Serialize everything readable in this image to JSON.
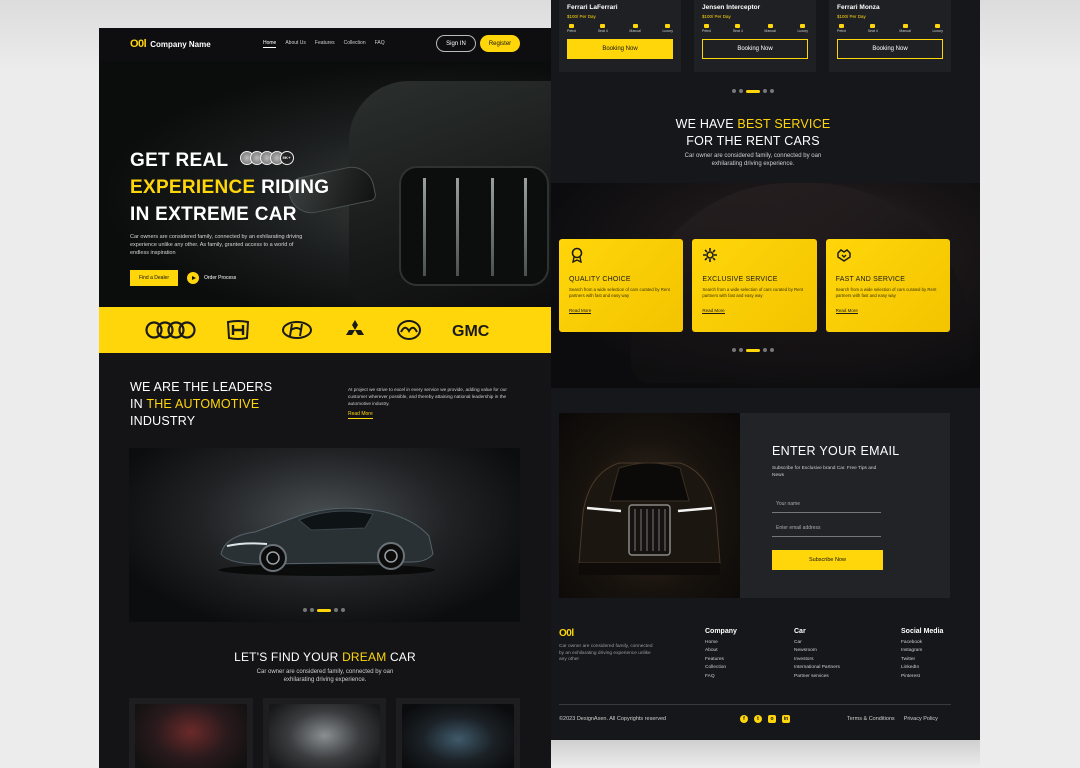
{
  "nav": {
    "logo_mark": "O0l",
    "company": "Company Name",
    "links": [
      "Home",
      "About Us",
      "Features",
      "Collection",
      "FAQ"
    ],
    "signin": "Sign IN",
    "register": "Register"
  },
  "hero": {
    "line1": "GET REAL",
    "line2_accent": "EXPERIENCE",
    "line2_rest": " RIDING",
    "line3": "IN EXTREME CAR",
    "avatar_count": "5K+",
    "desc": "Car owners are considered family, connected by an exhilarating driving experience unlike any other. As family, granted access to a world of endless inspiration",
    "btn_dealer": "Find a Dealer",
    "order_process": "Order Process"
  },
  "brands": [
    "audi",
    "honda",
    "hyundai",
    "mitsubishi",
    "mazda",
    "gmc"
  ],
  "brand_gmc_text": "GMC",
  "leaders": {
    "line1": "WE ARE THE LEADERS",
    "line2_pre": "IN ",
    "line2_accent": "THE AUTOMOTIVE",
    "line3": "INDUSTRY",
    "desc": "At project we strive to excel in every service we provide, adding value for our customer wherever possible, and thereby attaining national leadership in the automotive industry.",
    "link": "Read More"
  },
  "dream": {
    "title_pre": "LET'S FIND YOUR ",
    "title_accent": "DREAM",
    "title_post": " CAR",
    "desc_line1": "Car owner are considered family, connected by oan",
    "desc_line2": "exhilarating driving experience."
  },
  "rent_cards": [
    {
      "name": "Ferrari LaFerrari",
      "price": "$100/ Per Day",
      "specs": [
        "Petrol",
        "Seat 4",
        "Manual",
        "Luxury"
      ],
      "button": "Booking Now",
      "style": "filled"
    },
    {
      "name": "Jensen Interceptor",
      "price": "$100/ Per Day",
      "specs": [
        "Petrol",
        "Seat 4",
        "Manual",
        "Luxury"
      ],
      "button": "Booking Now",
      "style": "outline"
    },
    {
      "name": "Ferrari Monza",
      "price": "$100/ Per Day",
      "specs": [
        "Petrol",
        "Seat 4",
        "Manual",
        "Luxury"
      ],
      "button": "Booking Now",
      "style": "outline"
    }
  ],
  "best": {
    "line1_pre": "WE HAVE ",
    "line1_accent": "BEST SERVICE",
    "line2": "FOR THE RENT CARS",
    "desc_line1": "Car owner are considered family, connected by oan",
    "desc_line2": "exhilarating driving experience."
  },
  "services": [
    {
      "icon": "award-icon",
      "name": "QUALITY CHOICE",
      "desc": "Search from a wide selection of cars curated by Rent partners with fast and easy way",
      "link": "Read More"
    },
    {
      "icon": "gear-icon",
      "name": "EXCLUSIVE SERVICE",
      "desc": "Search from a wide selection of cars curated by Rent partners with fast and easy way",
      "link": "Read More"
    },
    {
      "icon": "handshake-icon",
      "name": "FAST AND SERVICE",
      "desc": "Search from a wide selection of cars curated by Rent partners with fast and easy way",
      "link": "Read More"
    }
  ],
  "email": {
    "title": "ENTER YOUR EMAIL",
    "desc": "Subscribe for Exclusive brand Car. Free Tips and News",
    "name_placeholder": "Your name",
    "email_placeholder": "Enter email address",
    "button": "Subscribe Now"
  },
  "footer": {
    "logo": "O0l",
    "about": "Car owner are considered family, connected by an exhilarating driving experience unlike any other",
    "columns": [
      {
        "title": "Company",
        "links": [
          "Home",
          "About",
          "Features",
          "Collection",
          "FAQ"
        ]
      },
      {
        "title": "Car",
        "links": [
          "Car",
          "Newsroom",
          "Investors",
          "International Partners",
          "Partner services"
        ]
      },
      {
        "title": "Social Media",
        "links": [
          "Facebook",
          "Instagram",
          "Twitter",
          "LinkedIn",
          "Pinterest"
        ]
      }
    ],
    "copyright": "©2023 DesignAxen. All Copyrights reserved",
    "socials": [
      "f",
      "t",
      "o",
      "in"
    ],
    "terms": "Terms & Conditions",
    "privacy": "Privacy Policy"
  },
  "colors": {
    "accent": "#ffd60a",
    "bg": "#141416",
    "panel": "#1f2024"
  }
}
